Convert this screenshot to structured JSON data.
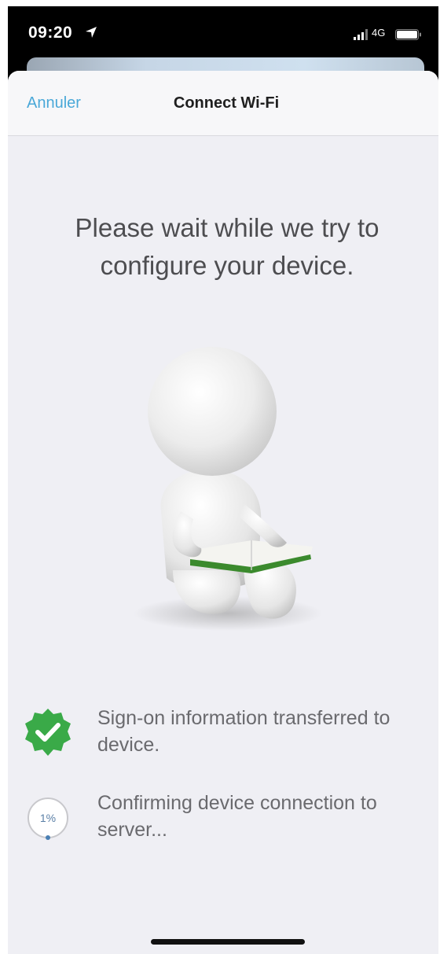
{
  "status_bar": {
    "time": "09:20",
    "network": "4G"
  },
  "nav": {
    "cancel_label": "Annuler",
    "title": "Connect Wi-Fi"
  },
  "main": {
    "headline": "Please wait while we try to configure your device."
  },
  "steps": [
    {
      "text": "Sign-on information transferred to device.",
      "state": "done",
      "icon": "check-badge-icon"
    },
    {
      "text": "Confirming device connection to server...",
      "state": "in-progress",
      "icon": "progress-ring-icon",
      "progress_label": "1%",
      "progress": 0.01
    }
  ],
  "colors": {
    "accent": "#4aa8d8",
    "success": "#3aaa48",
    "background": "#efeff4"
  }
}
